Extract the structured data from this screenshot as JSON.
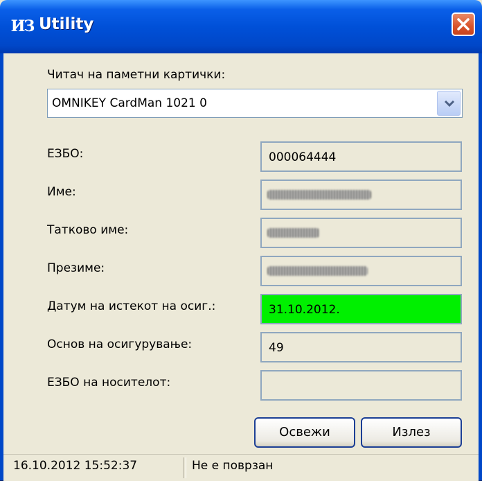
{
  "window": {
    "title": "Utility",
    "logo": "ИЗ"
  },
  "reader": {
    "label": "Читач на паметни картички:",
    "selected": "OMNIKEY CardMan 1021 0"
  },
  "fields": {
    "ezbo": {
      "label": "ЕЗБО:",
      "value": "000064444"
    },
    "ime": {
      "label": "Име:",
      "value": ""
    },
    "tatkovo_ime": {
      "label": "Татково име:",
      "value": ""
    },
    "prezime": {
      "label": "Презиме:",
      "value": ""
    },
    "datum": {
      "label": "Датум на истекот на осиг.:",
      "value": "31.10.2012."
    },
    "osnov": {
      "label": "Основ на осигурување:",
      "value": "49"
    },
    "ezbo_nositel": {
      "label": "ЕЗБО на носителот:",
      "value": ""
    }
  },
  "buttons": {
    "refresh": "Освежи",
    "exit": "Излез"
  },
  "status": {
    "datetime": "16.10.2012 15:52:37",
    "connection": "Не е поврзан"
  },
  "colors": {
    "title_bar": "#0050d8",
    "highlight_field": "#00f000",
    "close_button": "#d9532b"
  }
}
